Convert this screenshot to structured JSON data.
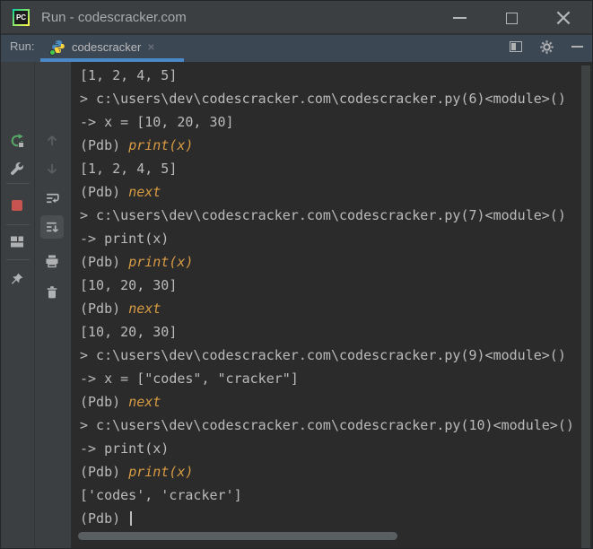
{
  "window": {
    "title": "Run - codescracker.com",
    "logo_text": "PC",
    "controls": {
      "minimize": "minimize",
      "maximize": "maximize",
      "close": "×"
    }
  },
  "tab_bar": {
    "run_label": "Run:",
    "tab_label": "codescracker",
    "tab_close": "×",
    "right_icons": [
      "float-window-icon",
      "settings-gear-icon",
      "hide-icon"
    ]
  },
  "left_toolbar": {
    "run_column_icons": [
      "rerun-icon",
      "wrench-icon",
      "stop-icon",
      "layout-icon",
      "pin-icon"
    ],
    "console_column_icons": [
      "up-arrow-icon",
      "down-arrow-icon",
      "soft-wrap-icon",
      "scroll-to-end-icon",
      "print-icon",
      "clear-trash-icon"
    ],
    "selected_icon": "scroll-to-end-icon"
  },
  "console": {
    "lines": [
      {
        "segments": [
          {
            "text": "[1, 2, 4, 5]",
            "style": "plain"
          }
        ]
      },
      {
        "segments": [
          {
            "text": "> c:\\users\\dev\\codescracker.com\\codescracker.py(6)<module>()",
            "style": "plain"
          }
        ]
      },
      {
        "segments": [
          {
            "text": "-> x = [10, 20, 30]",
            "style": "plain"
          }
        ]
      },
      {
        "segments": [
          {
            "text": "(Pdb) ",
            "style": "plain"
          },
          {
            "text": "print(x)",
            "style": "command"
          }
        ]
      },
      {
        "segments": [
          {
            "text": "[1, 2, 4, 5]",
            "style": "plain"
          }
        ]
      },
      {
        "segments": [
          {
            "text": "(Pdb) ",
            "style": "plain"
          },
          {
            "text": "next",
            "style": "command"
          }
        ]
      },
      {
        "segments": [
          {
            "text": "> c:\\users\\dev\\codescracker.com\\codescracker.py(7)<module>()",
            "style": "plain"
          }
        ]
      },
      {
        "segments": [
          {
            "text": "-> print(x)",
            "style": "plain"
          }
        ]
      },
      {
        "segments": [
          {
            "text": "(Pdb) ",
            "style": "plain"
          },
          {
            "text": "print(x)",
            "style": "command"
          }
        ]
      },
      {
        "segments": [
          {
            "text": "[10, 20, 30]",
            "style": "plain"
          }
        ]
      },
      {
        "segments": [
          {
            "text": "(Pdb) ",
            "style": "plain"
          },
          {
            "text": "next",
            "style": "command"
          }
        ]
      },
      {
        "segments": [
          {
            "text": "[10, 20, 30]",
            "style": "plain"
          }
        ]
      },
      {
        "segments": [
          {
            "text": "> c:\\users\\dev\\codescracker.com\\codescracker.py(9)<module>()",
            "style": "plain"
          }
        ]
      },
      {
        "segments": [
          {
            "text": "-> x = [\"codes\", \"cracker\"]",
            "style": "plain"
          }
        ]
      },
      {
        "segments": [
          {
            "text": "(Pdb) ",
            "style": "plain"
          },
          {
            "text": "next",
            "style": "command"
          }
        ]
      },
      {
        "segments": [
          {
            "text": "> c:\\users\\dev\\codescracker.com\\codescracker.py(10)<module>()",
            "style": "plain"
          }
        ]
      },
      {
        "segments": [
          {
            "text": "-> print(x)",
            "style": "plain"
          }
        ]
      },
      {
        "segments": [
          {
            "text": "(Pdb) ",
            "style": "plain"
          },
          {
            "text": "print(x)",
            "style": "command"
          }
        ]
      },
      {
        "segments": [
          {
            "text": "['codes', 'cracker']",
            "style": "plain"
          }
        ]
      },
      {
        "segments": [
          {
            "text": "(Pdb) ",
            "style": "plain"
          }
        ],
        "cursor": true
      }
    ]
  },
  "colors": {
    "console_bg": "#2B2B2B",
    "plain_text": "#BBBBBB",
    "command_text": "#D79B43",
    "tab_underline": "#4A88C7",
    "titlebar_bg": "#3B3F42",
    "tabbar_bg": "#3C4754",
    "toolbar_bg": "#3C3F41",
    "stop_red": "#C75450",
    "rerun_green": "#59A869",
    "icon_gray": "#AFB1B3"
  }
}
